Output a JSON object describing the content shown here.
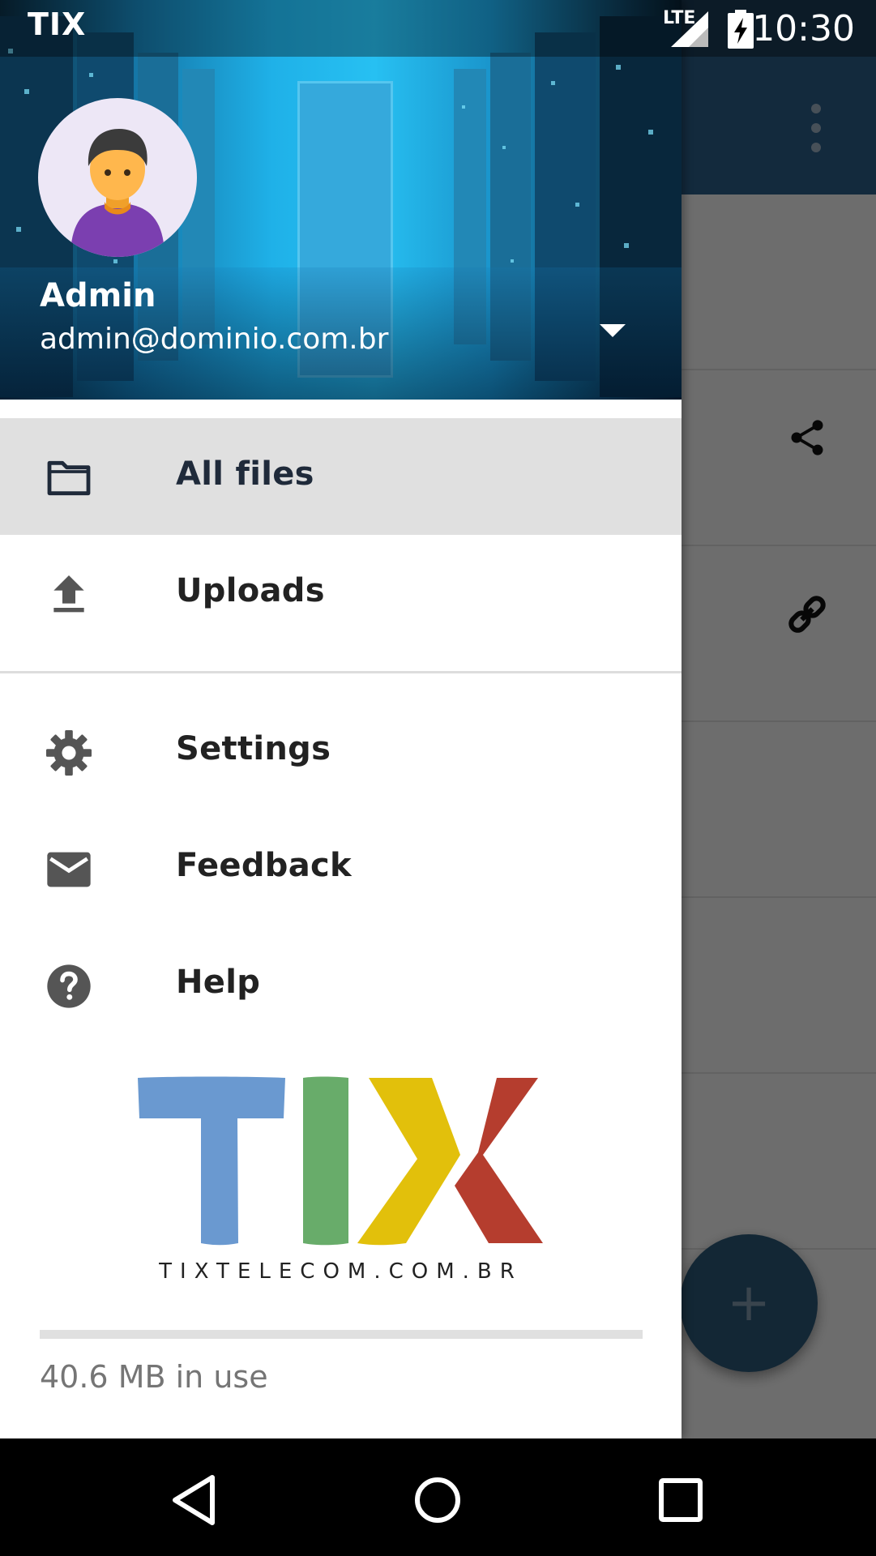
{
  "status_bar": {
    "app_name": "TIX",
    "network": "LTE",
    "time": "10:30"
  },
  "account": {
    "name": "Admin",
    "email": "admin@dominio.com.br"
  },
  "menu": {
    "items": [
      {
        "label": "All files",
        "icon": "folder-icon",
        "active": true
      },
      {
        "label": "Uploads",
        "icon": "upload-icon",
        "active": false
      },
      {
        "label": "Settings",
        "icon": "gear-icon",
        "active": false
      },
      {
        "label": "Feedback",
        "icon": "mail-icon",
        "active": false
      },
      {
        "label": "Help",
        "icon": "help-icon",
        "active": false
      }
    ]
  },
  "logo": {
    "letters": [
      "T",
      "I",
      "X"
    ],
    "colors": [
      "#6a99d0",
      "#68ac6a",
      "#e2c00b",
      "#b53d2e"
    ],
    "tagline": "TIXTELECOM.COM.BR"
  },
  "quota": {
    "text": "40.6 MB in use"
  },
  "background_app": {
    "fab_label": "+"
  },
  "colors": {
    "toolbar": "#2c5d87",
    "fab": "#2a5777",
    "active_item": "#e0e0e0"
  }
}
